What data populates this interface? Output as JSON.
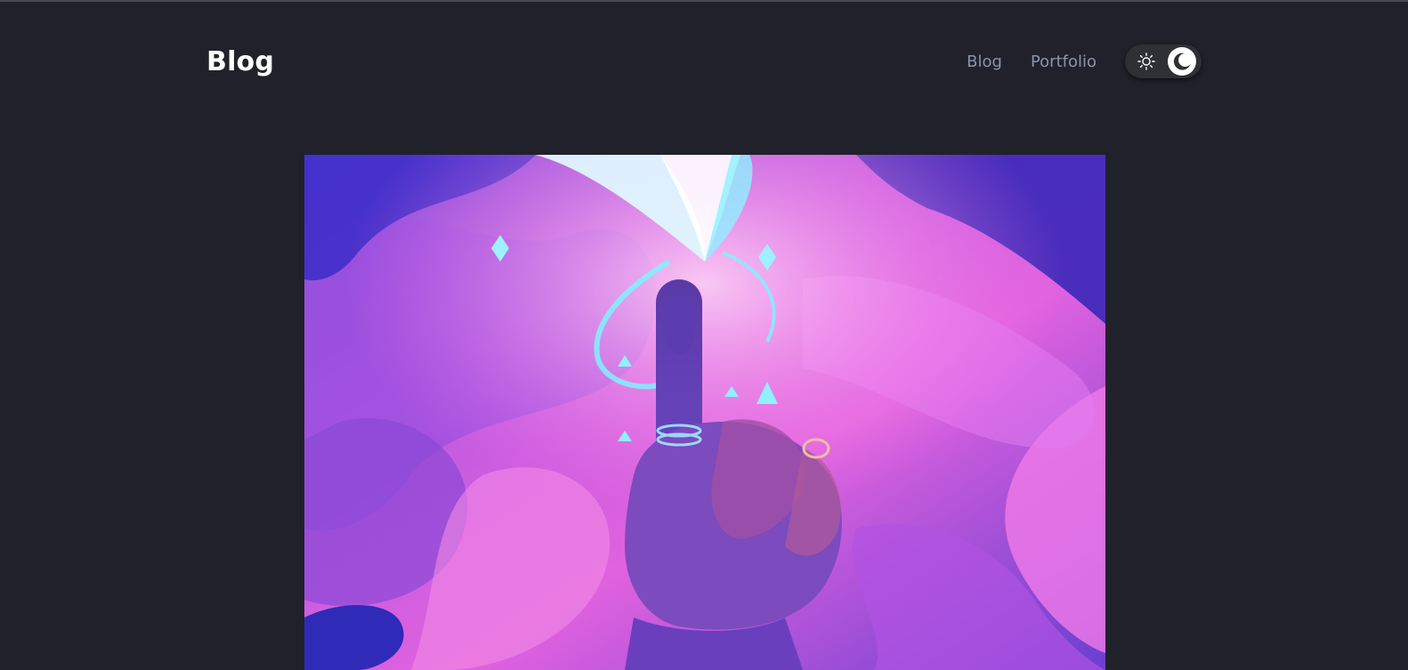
{
  "header": {
    "brand": "Blog",
    "nav": [
      {
        "label": "Blog"
      },
      {
        "label": "Portfolio"
      }
    ],
    "theme_toggle": {
      "sun_icon": "sun-icon",
      "moon_icon": "moon-icon",
      "active": "dark"
    }
  },
  "hero": {
    "image_icon": "illustration"
  },
  "colors": {
    "background": "#21212b",
    "nav_link": "#8b94a8",
    "brand": "#ffffff",
    "toggle_bg": "#2e3036"
  }
}
